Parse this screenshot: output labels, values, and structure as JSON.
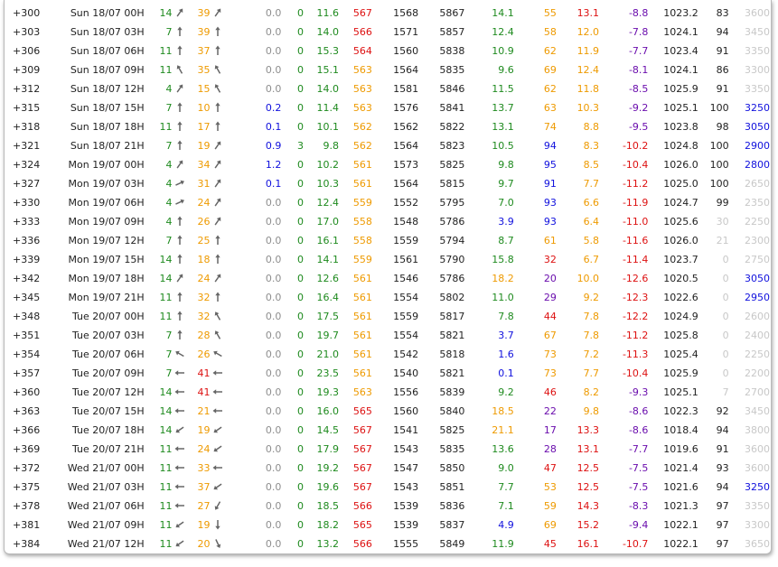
{
  "colors": {
    "dark": "#222222",
    "green": "#1e8a1e",
    "orange": "#ee9a00",
    "red": "#dd1111",
    "blue": "#1010dd",
    "purple": "#6a0dad",
    "grey": "#8e8e8e",
    "lightgrey": "#c8c8c8"
  },
  "rows": [
    {
      "step": "+300",
      "time": "Sun 18/07 00H",
      "ws": "14",
      "wdir": "arrow-ne-icon",
      "gust": "39",
      "gdir": "arrow-ne-icon",
      "prec": "0.0",
      "conv": "0",
      "temp": "11.6",
      "hum": "567",
      "frz": "1568",
      "thk": "5867",
      "t850": "14.1",
      "cape": "55",
      "li": "13.1",
      "t500": "-8.8",
      "mslp": "1023.2",
      "cloud": "83",
      "vis": "3600"
    },
    {
      "step": "+303",
      "time": "Sun 18/07 03H",
      "ws": "7",
      "wdir": "arrow-n-icon",
      "gust": "39",
      "gdir": "arrow-n-icon",
      "prec": "0.0",
      "conv": "0",
      "temp": "14.0",
      "hum": "566",
      "frz": "1571",
      "thk": "5857",
      "t850": "12.4",
      "cape": "58",
      "li": "12.0",
      "t500": "-7.8",
      "mslp": "1024.1",
      "cloud": "94",
      "vis": "3450"
    },
    {
      "step": "+306",
      "time": "Sun 18/07 06H",
      "ws": "11",
      "wdir": "arrow-n-icon",
      "gust": "37",
      "gdir": "arrow-n-icon",
      "prec": "0.0",
      "conv": "0",
      "temp": "15.3",
      "hum": "564",
      "frz": "1560",
      "thk": "5838",
      "t850": "10.9",
      "cape": "62",
      "li": "11.9",
      "t500": "-7.7",
      "mslp": "1023.4",
      "cloud": "91",
      "vis": "3350"
    },
    {
      "step": "+309",
      "time": "Sun 18/07 09H",
      "ws": "11",
      "wdir": "arrow-nw-icon",
      "gust": "35",
      "gdir": "arrow-nw-icon",
      "prec": "0.0",
      "conv": "0",
      "temp": "15.1",
      "hum": "563",
      "frz": "1564",
      "thk": "5835",
      "t850": "9.6",
      "cape": "69",
      "li": "12.4",
      "t500": "-8.1",
      "mslp": "1024.1",
      "cloud": "86",
      "vis": "3300"
    },
    {
      "step": "+312",
      "time": "Sun 18/07 12H",
      "ws": "4",
      "wdir": "arrow-ne-icon",
      "gust": "15",
      "gdir": "arrow-nw-icon",
      "prec": "0.0",
      "conv": "0",
      "temp": "14.0",
      "hum": "563",
      "frz": "1581",
      "thk": "5846",
      "t850": "11.5",
      "cape": "62",
      "li": "11.8",
      "t500": "-8.5",
      "mslp": "1025.9",
      "cloud": "91",
      "vis": "3350"
    },
    {
      "step": "+315",
      "time": "Sun 18/07 15H",
      "ws": "7",
      "wdir": "arrow-n-icon",
      "gust": "10",
      "gdir": "arrow-n-icon",
      "prec": "0.2",
      "conv": "0",
      "temp": "11.4",
      "hum": "563",
      "frz": "1576",
      "thk": "5841",
      "t850": "13.7",
      "cape": "63",
      "li": "10.3",
      "t500": "-9.2",
      "mslp": "1025.1",
      "cloud": "100",
      "vis": "3250"
    },
    {
      "step": "+318",
      "time": "Sun 18/07 18H",
      "ws": "11",
      "wdir": "arrow-n-icon",
      "gust": "17",
      "gdir": "arrow-n-icon",
      "prec": "0.1",
      "conv": "0",
      "temp": "10.1",
      "hum": "562",
      "frz": "1562",
      "thk": "5822",
      "t850": "13.1",
      "cape": "74",
      "li": "8.8",
      "t500": "-9.5",
      "mslp": "1023.8",
      "cloud": "98",
      "vis": "3050"
    },
    {
      "step": "+321",
      "time": "Sun 18/07 21H",
      "ws": "7",
      "wdir": "arrow-n-icon",
      "gust": "19",
      "gdir": "arrow-ne-icon",
      "prec": "0.9",
      "conv": "3",
      "temp": "9.8",
      "hum": "562",
      "frz": "1564",
      "thk": "5823",
      "t850": "10.5",
      "cape": "94",
      "li": "8.3",
      "t500": "-10.2",
      "mslp": "1024.8",
      "cloud": "100",
      "vis": "2900"
    },
    {
      "step": "+324",
      "time": "Mon 19/07 00H",
      "ws": "4",
      "wdir": "arrow-ne-icon",
      "gust": "34",
      "gdir": "arrow-ne-icon",
      "prec": "1.2",
      "conv": "0",
      "temp": "10.2",
      "hum": "561",
      "frz": "1573",
      "thk": "5825",
      "t850": "9.8",
      "cape": "95",
      "li": "8.5",
      "t500": "-10.4",
      "mslp": "1026.0",
      "cloud": "100",
      "vis": "2800"
    },
    {
      "step": "+327",
      "time": "Mon 19/07 03H",
      "ws": "4",
      "wdir": "arrow-ene-icon",
      "gust": "31",
      "gdir": "arrow-ne-icon",
      "prec": "0.1",
      "conv": "0",
      "temp": "10.3",
      "hum": "561",
      "frz": "1564",
      "thk": "5815",
      "t850": "9.7",
      "cape": "91",
      "li": "7.7",
      "t500": "-11.2",
      "mslp": "1025.0",
      "cloud": "100",
      "vis": "2650"
    },
    {
      "step": "+330",
      "time": "Mon 19/07 06H",
      "ws": "4",
      "wdir": "arrow-ene-icon",
      "gust": "24",
      "gdir": "arrow-ne-icon",
      "prec": "0.0",
      "conv": "0",
      "temp": "12.4",
      "hum": "559",
      "frz": "1552",
      "thk": "5795",
      "t850": "7.0",
      "cape": "93",
      "li": "6.6",
      "t500": "-11.9",
      "mslp": "1024.7",
      "cloud": "99",
      "vis": "2350"
    },
    {
      "step": "+333",
      "time": "Mon 19/07 09H",
      "ws": "4",
      "wdir": "arrow-n-icon",
      "gust": "26",
      "gdir": "arrow-ne-icon",
      "prec": "0.0",
      "conv": "0",
      "temp": "17.0",
      "hum": "558",
      "frz": "1548",
      "thk": "5786",
      "t850": "3.9",
      "cape": "93",
      "li": "6.4",
      "t500": "-11.0",
      "mslp": "1025.6",
      "cloud": "30",
      "vis": "2250"
    },
    {
      "step": "+336",
      "time": "Mon 19/07 12H",
      "ws": "7",
      "wdir": "arrow-n-icon",
      "gust": "25",
      "gdir": "arrow-n-icon",
      "prec": "0.0",
      "conv": "0",
      "temp": "16.1",
      "hum": "558",
      "frz": "1559",
      "thk": "5794",
      "t850": "8.7",
      "cape": "61",
      "li": "5.8",
      "t500": "-11.6",
      "mslp": "1026.0",
      "cloud": "21",
      "vis": "2300"
    },
    {
      "step": "+339",
      "time": "Mon 19/07 15H",
      "ws": "14",
      "wdir": "arrow-n-icon",
      "gust": "18",
      "gdir": "arrow-n-icon",
      "prec": "0.0",
      "conv": "0",
      "temp": "14.1",
      "hum": "559",
      "frz": "1561",
      "thk": "5790",
      "t850": "15.8",
      "cape": "32",
      "li": "6.7",
      "t500": "-11.4",
      "mslp": "1023.7",
      "cloud": "0",
      "vis": "2750"
    },
    {
      "step": "+342",
      "time": "Mon 19/07 18H",
      "ws": "14",
      "wdir": "arrow-ne-icon",
      "gust": "24",
      "gdir": "arrow-ne-icon",
      "prec": "0.0",
      "conv": "0",
      "temp": "12.6",
      "hum": "561",
      "frz": "1546",
      "thk": "5786",
      "t850": "18.2",
      "cape": "20",
      "li": "10.0",
      "t500": "-12.6",
      "mslp": "1020.5",
      "cloud": "0",
      "vis": "3050"
    },
    {
      "step": "+345",
      "time": "Mon 19/07 21H",
      "ws": "11",
      "wdir": "arrow-n-icon",
      "gust": "32",
      "gdir": "arrow-n-icon",
      "prec": "0.0",
      "conv": "0",
      "temp": "16.4",
      "hum": "561",
      "frz": "1554",
      "thk": "5802",
      "t850": "11.0",
      "cape": "29",
      "li": "9.2",
      "t500": "-12.3",
      "mslp": "1022.6",
      "cloud": "0",
      "vis": "2950"
    },
    {
      "step": "+348",
      "time": "Tue 20/07 00H",
      "ws": "11",
      "wdir": "arrow-n-icon",
      "gust": "32",
      "gdir": "arrow-nw-icon",
      "prec": "0.0",
      "conv": "0",
      "temp": "17.5",
      "hum": "561",
      "frz": "1559",
      "thk": "5817",
      "t850": "7.8",
      "cape": "44",
      "li": "7.8",
      "t500": "-12.2",
      "mslp": "1024.9",
      "cloud": "0",
      "vis": "2600"
    },
    {
      "step": "+351",
      "time": "Tue 20/07 03H",
      "ws": "7",
      "wdir": "arrow-n-icon",
      "gust": "28",
      "gdir": "arrow-nw-icon",
      "prec": "0.0",
      "conv": "0",
      "temp": "19.7",
      "hum": "561",
      "frz": "1554",
      "thk": "5821",
      "t850": "3.7",
      "cape": "67",
      "li": "7.8",
      "t500": "-11.2",
      "mslp": "1025.8",
      "cloud": "0",
      "vis": "2400"
    },
    {
      "step": "+354",
      "time": "Tue 20/07 06H",
      "ws": "7",
      "wdir": "arrow-wnw-icon",
      "gust": "26",
      "gdir": "arrow-wnw-icon",
      "prec": "0.0",
      "conv": "0",
      "temp": "21.0",
      "hum": "561",
      "frz": "1542",
      "thk": "5818",
      "t850": "1.6",
      "cape": "73",
      "li": "7.2",
      "t500": "-11.3",
      "mslp": "1025.4",
      "cloud": "0",
      "vis": "2250"
    },
    {
      "step": "+357",
      "time": "Tue 20/07 09H",
      "ws": "7",
      "wdir": "arrow-w-icon",
      "gust": "41",
      "gdir": "arrow-w-icon",
      "prec": "0.0",
      "conv": "0",
      "temp": "23.5",
      "hum": "561",
      "frz": "1540",
      "thk": "5821",
      "t850": "0.1",
      "cape": "73",
      "li": "7.7",
      "t500": "-10.4",
      "mslp": "1025.9",
      "cloud": "0",
      "vis": "2200"
    },
    {
      "step": "+360",
      "time": "Tue 20/07 12H",
      "ws": "14",
      "wdir": "arrow-w-icon",
      "gust": "41",
      "gdir": "arrow-w-icon",
      "prec": "0.0",
      "conv": "0",
      "temp": "19.3",
      "hum": "563",
      "frz": "1556",
      "thk": "5839",
      "t850": "9.2",
      "cape": "46",
      "li": "8.2",
      "t500": "-9.3",
      "mslp": "1025.1",
      "cloud": "7",
      "vis": "2700"
    },
    {
      "step": "+363",
      "time": "Tue 20/07 15H",
      "ws": "14",
      "wdir": "arrow-w-icon",
      "gust": "21",
      "gdir": "arrow-w-icon",
      "prec": "0.0",
      "conv": "0",
      "temp": "16.0",
      "hum": "565",
      "frz": "1560",
      "thk": "5840",
      "t850": "18.5",
      "cape": "22",
      "li": "9.8",
      "t500": "-8.6",
      "mslp": "1022.3",
      "cloud": "92",
      "vis": "3450"
    },
    {
      "step": "+366",
      "time": "Tue 20/07 18H",
      "ws": "14",
      "wdir": "arrow-sw-icon",
      "gust": "19",
      "gdir": "arrow-sw-icon",
      "prec": "0.0",
      "conv": "0",
      "temp": "14.5",
      "hum": "567",
      "frz": "1541",
      "thk": "5825",
      "t850": "21.1",
      "cape": "17",
      "li": "13.3",
      "t500": "-8.6",
      "mslp": "1018.4",
      "cloud": "94",
      "vis": "3800"
    },
    {
      "step": "+369",
      "time": "Tue 20/07 21H",
      "ws": "11",
      "wdir": "arrow-w-icon",
      "gust": "24",
      "gdir": "arrow-sw-icon",
      "prec": "0.0",
      "conv": "0",
      "temp": "17.9",
      "hum": "567",
      "frz": "1543",
      "thk": "5835",
      "t850": "13.6",
      "cape": "28",
      "li": "13.1",
      "t500": "-7.7",
      "mslp": "1019.6",
      "cloud": "91",
      "vis": "3600"
    },
    {
      "step": "+372",
      "time": "Wed 21/07 00H",
      "ws": "11",
      "wdir": "arrow-w-icon",
      "gust": "33",
      "gdir": "arrow-w-icon",
      "prec": "0.0",
      "conv": "0",
      "temp": "19.2",
      "hum": "567",
      "frz": "1547",
      "thk": "5850",
      "t850": "9.0",
      "cape": "47",
      "li": "12.5",
      "t500": "-7.5",
      "mslp": "1021.4",
      "cloud": "93",
      "vis": "3600"
    },
    {
      "step": "+375",
      "time": "Wed 21/07 03H",
      "ws": "11",
      "wdir": "arrow-w-icon",
      "gust": "37",
      "gdir": "arrow-sw-icon",
      "prec": "0.0",
      "conv": "0",
      "temp": "19.6",
      "hum": "567",
      "frz": "1543",
      "thk": "5851",
      "t850": "7.7",
      "cape": "53",
      "li": "12.5",
      "t500": "-7.5",
      "mslp": "1021.6",
      "cloud": "94",
      "vis": "3250"
    },
    {
      "step": "+378",
      "time": "Wed 21/07 06H",
      "ws": "11",
      "wdir": "arrow-w-icon",
      "gust": "27",
      "gdir": "arrow-ssw-icon",
      "prec": "0.0",
      "conv": "0",
      "temp": "18.5",
      "hum": "566",
      "frz": "1539",
      "thk": "5836",
      "t850": "7.1",
      "cape": "59",
      "li": "14.3",
      "t500": "-8.3",
      "mslp": "1021.3",
      "cloud": "97",
      "vis": "3350"
    },
    {
      "step": "+381",
      "time": "Wed 21/07 09H",
      "ws": "11",
      "wdir": "arrow-sw-icon",
      "gust": "19",
      "gdir": "arrow-s-icon",
      "prec": "0.0",
      "conv": "0",
      "temp": "18.2",
      "hum": "565",
      "frz": "1539",
      "thk": "5837",
      "t850": "4.9",
      "cape": "69",
      "li": "15.2",
      "t500": "-9.4",
      "mslp": "1022.1",
      "cloud": "97",
      "vis": "3300"
    },
    {
      "step": "+384",
      "time": "Wed 21/07 12H",
      "ws": "11",
      "wdir": "arrow-sw-icon",
      "gust": "20",
      "gdir": "arrow-sse-icon",
      "prec": "0.0",
      "conv": "0",
      "temp": "13.2",
      "hum": "566",
      "frz": "1555",
      "thk": "5849",
      "t850": "11.9",
      "cape": "45",
      "li": "16.1",
      "t500": "-10.7",
      "mslp": "1022.1",
      "cloud": "97",
      "vis": "3650"
    }
  ]
}
